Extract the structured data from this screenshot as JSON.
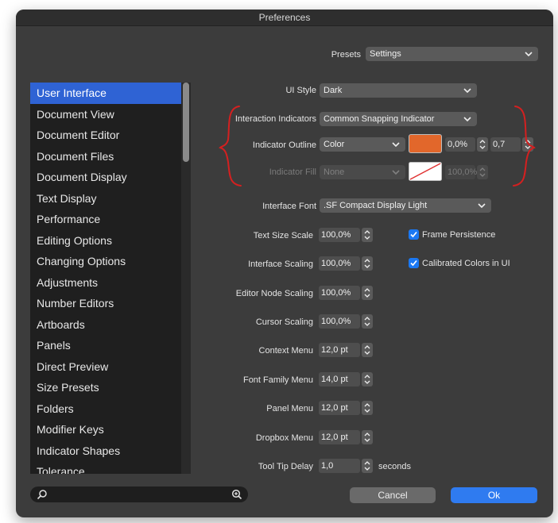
{
  "window": {
    "title": "Preferences"
  },
  "presets": {
    "label": "Presets",
    "value": "Settings"
  },
  "sidebar": {
    "items": [
      {
        "label": "User Interface",
        "selected": true
      },
      {
        "label": "Document View"
      },
      {
        "label": "Document Editor"
      },
      {
        "label": "Document Files"
      },
      {
        "label": "Document Display"
      },
      {
        "label": "Text Display"
      },
      {
        "label": "Performance"
      },
      {
        "label": "Editing Options"
      },
      {
        "label": "Changing Options"
      },
      {
        "label": "Adjustments"
      },
      {
        "label": "Number Editors"
      },
      {
        "label": "Artboards"
      },
      {
        "label": "Panels"
      },
      {
        "label": "Direct Preview"
      },
      {
        "label": "Size Presets"
      },
      {
        "label": "Folders"
      },
      {
        "label": "Modifier Keys"
      },
      {
        "label": "Indicator Shapes"
      },
      {
        "label": "Tolerance"
      }
    ]
  },
  "settings": {
    "ui_style": {
      "label": "UI Style",
      "value": "Dark"
    },
    "interaction_indicators": {
      "label": "Interaction Indicators",
      "value": "Common Snapping Indicator"
    },
    "indicator_outline": {
      "label": "Indicator Outline",
      "value": "Color",
      "color": "#e2672b",
      "percent": "0,0%",
      "width": "0,7"
    },
    "indicator_fill": {
      "label": "Indicator Fill",
      "value": "None",
      "percent": "100,0%"
    },
    "interface_font": {
      "label": "Interface Font",
      "value": ".SF Compact Display Light"
    },
    "text_size_scale": {
      "label": "Text Size Scale",
      "value": "100,0%"
    },
    "interface_scaling": {
      "label": "Interface Scaling",
      "value": "100,0%"
    },
    "editor_node_scaling": {
      "label": "Editor Node Scaling",
      "value": "100,0%"
    },
    "cursor_scaling": {
      "label": "Cursor Scaling",
      "value": "100,0%"
    },
    "context_menu": {
      "label": "Context Menu",
      "value": "12,0 pt"
    },
    "font_family_menu": {
      "label": "Font Family Menu",
      "value": "14,0 pt"
    },
    "panel_menu": {
      "label": "Panel Menu",
      "value": "12,0 pt"
    },
    "dropbox_menu": {
      "label": "Dropbox Menu",
      "value": "12,0 pt"
    },
    "tool_tip_delay": {
      "label": "Tool Tip Delay",
      "value": "1,0",
      "unit": "seconds"
    },
    "frame_persistence": {
      "label": "Frame Persistence",
      "checked": true
    },
    "calibrated_colors": {
      "label": "Calibrated Colors in UI",
      "checked": true
    }
  },
  "footer": {
    "cancel_label": "Cancel",
    "ok_label": "Ok",
    "search_placeholder": ""
  },
  "colors": {
    "accent": "#2f7bf0",
    "selection": "#2f63d4",
    "annotation": "#d42020"
  }
}
